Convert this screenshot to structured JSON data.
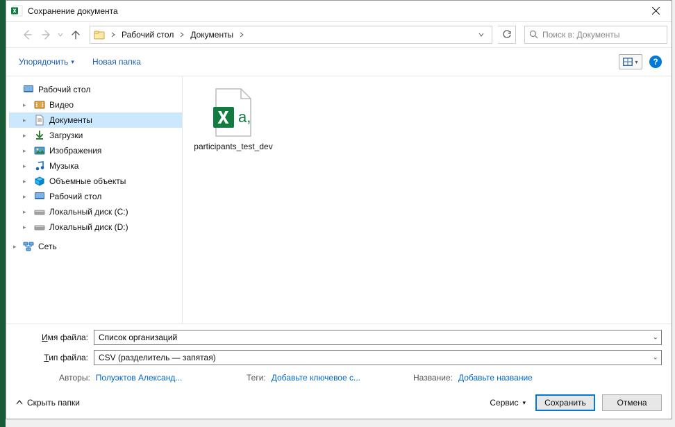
{
  "titlebar": {
    "title": "Сохранение документа"
  },
  "nav": {
    "breadcrumbs": [
      "Рабочий стол",
      "Документы"
    ],
    "refresh_tooltip": "Обновить"
  },
  "search": {
    "placeholder": "Поиск в: Документы"
  },
  "toolbar": {
    "organize_label": "Упорядочить",
    "new_folder_label": "Новая папка"
  },
  "tree": {
    "root": "Рабочий стол",
    "items": [
      {
        "label": "Видео",
        "icon": "video"
      },
      {
        "label": "Документы",
        "icon": "document",
        "selected": true
      },
      {
        "label": "Загрузки",
        "icon": "download"
      },
      {
        "label": "Изображения",
        "icon": "images"
      },
      {
        "label": "Музыка",
        "icon": "music"
      },
      {
        "label": "Объемные объекты",
        "icon": "3d"
      },
      {
        "label": "Рабочий стол",
        "icon": "desktop"
      },
      {
        "label": "Локальный диск (C:)",
        "icon": "drive"
      },
      {
        "label": "Локальный диск (D:)",
        "icon": "drive"
      }
    ],
    "network": "Сеть"
  },
  "files": {
    "items": [
      {
        "label": "participants_test_dev",
        "type": "csv"
      }
    ]
  },
  "footer": {
    "filename_label_prefix": "И",
    "filename_label_rest": "мя файла:",
    "filename_value": "Список организаций",
    "filetype_label_prefix": "Т",
    "filetype_label_rest": "ип файла:",
    "filetype_value": "CSV (разделитель — запятая)",
    "meta": {
      "authors_label": "Авторы:",
      "authors_value": "Полуэктов Александ...",
      "tags_label": "Теги:",
      "tags_value": "Добавьте ключевое с...",
      "title_label": "Название:",
      "title_value": "Добавьте название"
    }
  },
  "actions": {
    "hide_folders": "Скрыть папки",
    "tools_label": "Сервис",
    "save_label": "Сохранить",
    "cancel_label": "Отмена"
  }
}
